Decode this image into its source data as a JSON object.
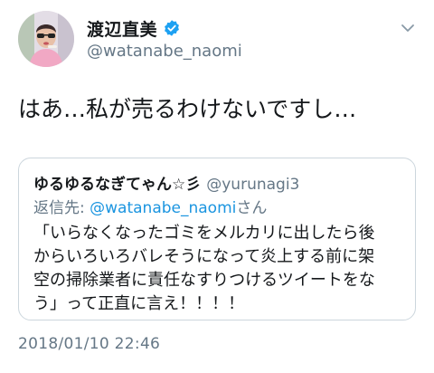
{
  "author": {
    "display_name": "渡辺直美",
    "username": "@watanabe_naomi",
    "verified": true,
    "avatar": "profile-photo"
  },
  "tweet": {
    "text": "はあ…私が売るわけないですし…",
    "timestamp": "2018/01/10 22:46"
  },
  "quoted_tweet": {
    "display_name": "ゆるゆるなぎてゃん☆彡",
    "username": "@yurunagi3",
    "reply_label": "返信先: ",
    "reply_to": "@watanabe_naomi",
    "reply_suffix": "さん",
    "text_lines": [
      "「いらなくなったゴミをメルカリに出したら後",
      "からいろいろバレそうになって炎上する前に架",
      "空の掃除業者に責任なすりつけるツイートをな",
      "う」って正直に言え！！！！"
    ]
  },
  "icons": {
    "verified": "verified-badge-icon",
    "menu": "chevron-down-icon"
  },
  "colors": {
    "primary_text": "#14171a",
    "secondary_text": "#657786",
    "link": "#1b95e0",
    "verified": "#1da1f2",
    "border": "#ccd6dd"
  }
}
